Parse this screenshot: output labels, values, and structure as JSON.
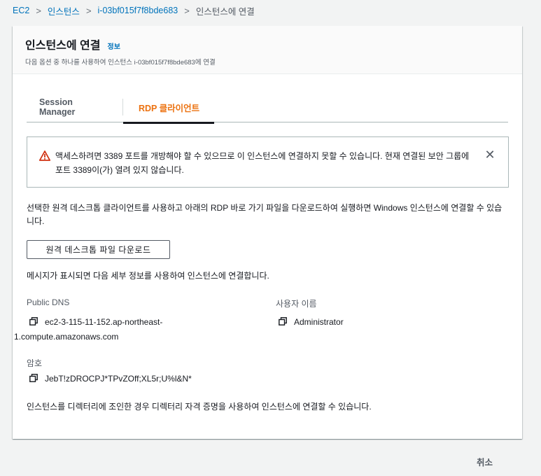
{
  "breadcrumb": {
    "items": [
      "EC2",
      "인스턴스",
      "i-03bf015f7f8bde683",
      "인스턴스에 연결"
    ],
    "separator": ">"
  },
  "header": {
    "title": "인스턴스에 연결",
    "info": "정보",
    "subtitle": "다음 옵션 중 하나를 사용하여 인스턴스 i-03bf015f7f8bde683에 연결"
  },
  "tabs": [
    {
      "label": "Session Manager",
      "active": false
    },
    {
      "label": "RDP 클라이언트",
      "active": true
    }
  ],
  "alert": {
    "icon": "warning-icon",
    "text": "액세스하려면 3389 포트를 개방해야 할 수 있으므로 이 인스턴스에 연결하지 못할 수 있습니다. 현재 연결된 보안 그룹에 포트 3389이(가) 열려 있지 않습니다.",
    "close": "✕"
  },
  "main": {
    "description": "선택한 원격 데스크톱 클라이언트를 사용하고 아래의 RDP 바로 가기 파일을 다운로드하여 실행하면 Windows 인스턴스에 연결할 수 있습니다.",
    "download_button": "원격 데스크톱 파일 다운로드",
    "prompt": "메시지가 표시되면 다음 세부 정보를 사용하여 인스턴스에 연결합니다.",
    "public_dns_label": "Public DNS",
    "public_dns_line1": "ec2-3-115-11-152.ap-northeast-",
    "public_dns_line2": "1.compute.amazonaws.com",
    "username_label": "사용자 이름",
    "username_value": "Administrator",
    "password_label": "암호",
    "password_value": "JebT!zDROCPJ*TPvZOff;XL5r;U%l&N*",
    "footer_note": "인스턴스를 디렉터리에 조인한 경우 디렉터리 자격 증명을 사용하여 인스턴스에 연결할 수 있습니다."
  },
  "footer": {
    "cancel": "취소"
  },
  "colors": {
    "link": "#0073bb",
    "active_tab": "#ec7211",
    "warning": "#d13212"
  }
}
